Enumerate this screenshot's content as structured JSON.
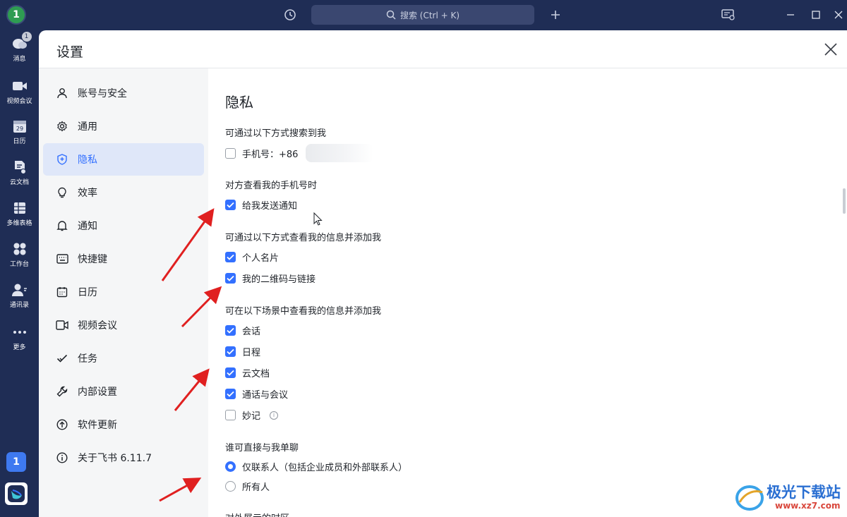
{
  "topbar": {
    "avatar_text": "1",
    "search_placeholder": "搜索 (Ctrl + K)"
  },
  "rail": {
    "items": [
      {
        "label": "消息",
        "icon": "chat-bubble-icon",
        "badge": "1"
      },
      {
        "label": "视频会议",
        "icon": "video-camera-icon"
      },
      {
        "label": "日历",
        "icon": "calendar-icon",
        "day": "29"
      },
      {
        "label": "云文档",
        "icon": "cloud-document-icon"
      },
      {
        "label": "多维表格",
        "icon": "table-grid-icon"
      },
      {
        "label": "工作台",
        "icon": "workspace-grid-icon"
      },
      {
        "label": "通讯录",
        "icon": "contacts-icon"
      },
      {
        "label": "更多",
        "icon": "more-dots-icon"
      }
    ],
    "bottom_avatar": "1"
  },
  "dialog": {
    "title": "设置",
    "nav": [
      {
        "label": "账号与安全",
        "icon": "user-icon"
      },
      {
        "label": "通用",
        "icon": "gear-icon"
      },
      {
        "label": "隐私",
        "icon": "shield-icon",
        "active": true
      },
      {
        "label": "效率",
        "icon": "lightbulb-icon"
      },
      {
        "label": "通知",
        "icon": "bell-icon"
      },
      {
        "label": "快捷键",
        "icon": "keyboard-icon"
      },
      {
        "label": "日历",
        "icon": "calendar-icon"
      },
      {
        "label": "视频会议",
        "icon": "video-camera-icon"
      },
      {
        "label": "任务",
        "icon": "checkmark-icon"
      },
      {
        "label": "内部设置",
        "icon": "wrench-icon"
      },
      {
        "label": "软件更新",
        "icon": "arrow-up-circle-icon"
      },
      {
        "label": "关于飞书 6.11.7",
        "icon": "info-circle-icon"
      }
    ],
    "privacy": {
      "title": "隐私",
      "search_me_label": "可通过以下方式搜索到我",
      "phone_option": "手机号：+86",
      "view_phone_label": "对方查看我的手机号时",
      "notify_option": "给我发送通知",
      "view_info_label": "可通过以下方式查看我的信息并添加我",
      "card_option": "个人名片",
      "qrcode_option": "我的二维码与链接",
      "scenes_label": "可在以下场景中查看我的信息并添加我",
      "scene_chat": "会话",
      "scene_schedule": "日程",
      "scene_docs": "云文档",
      "scene_calls": "通话与会议",
      "scene_minutes": "妙记",
      "direct_chat_label": "谁可直接与我单聊",
      "contacts_only": "仅联系人（包括企业成员和外部联系人）",
      "everyone": "所有人",
      "timezone_label": "对外展示的时区"
    }
  },
  "watermark": {
    "line1": "极光下载站",
    "line2": "www.xz7.com"
  },
  "colors": {
    "accent": "#3370ff",
    "rail_bg": "#1f2d55",
    "arrow": "#e02020"
  }
}
